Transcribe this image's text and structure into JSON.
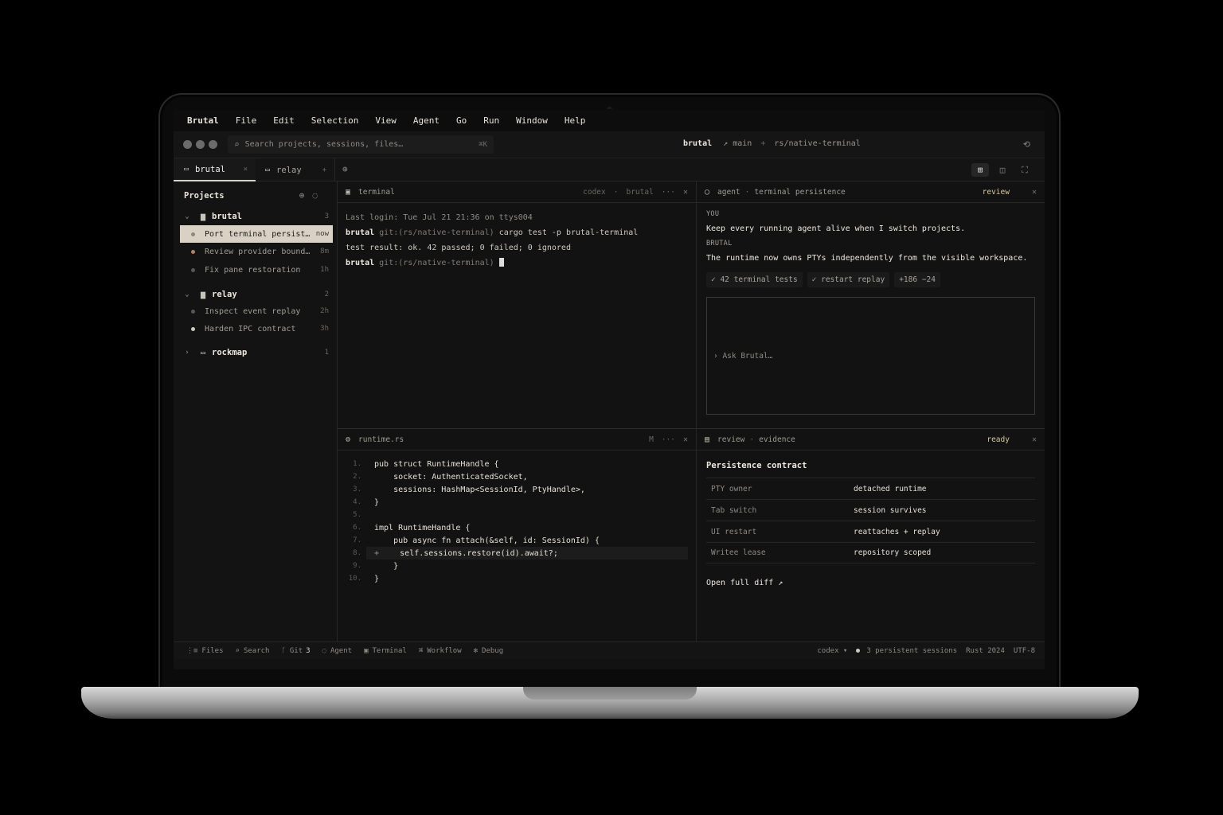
{
  "menu": [
    "Brutal",
    "File",
    "Edit",
    "Selection",
    "View",
    "Agent",
    "Go",
    "Run",
    "Window",
    "Help"
  ],
  "search": {
    "placeholder": "Search projects, sessions, files…",
    "shortcut": "⌘K"
  },
  "breadcrumb": {
    "project": "brutal",
    "branch_icon": "↗",
    "branch": "main",
    "sep": "+",
    "path": "rs/native-terminal"
  },
  "tabs": [
    {
      "label": "brutal",
      "close": "×"
    },
    {
      "label": "relay",
      "close": "+"
    }
  ],
  "sidebar": {
    "title": "Projects",
    "projects": [
      {
        "name": "brutal",
        "count": "3",
        "expanded": true,
        "sessions": [
          {
            "title": "Port terminal persist…",
            "time": "now",
            "active": true
          },
          {
            "title": "Review provider bound…",
            "time": "8m"
          },
          {
            "title": "Fix pane restoration",
            "time": "1h"
          }
        ]
      },
      {
        "name": "relay",
        "count": "2",
        "expanded": true,
        "sessions": [
          {
            "title": "Inspect event replay",
            "time": "2h"
          },
          {
            "title": "Harden IPC contract",
            "time": "3h"
          }
        ]
      },
      {
        "name": "rockmap",
        "count": "1",
        "expanded": false,
        "sessions": []
      }
    ]
  },
  "terminal": {
    "title": "terminal",
    "meta_provider": "codex",
    "meta_project": "brutal",
    "lines": {
      "login": "Last login: Tue Jul 21 21:36 on ttys004",
      "prompt": "brutal",
      "branch": "git:(rs/native-terminal)",
      "cmd": "cargo test -p brutal-terminal",
      "result": "test result: ok. 42 passed; 0 failed; 0 ignored"
    }
  },
  "agent": {
    "title": "agent",
    "subtitle": "terminal persistence",
    "status": "review",
    "you_label": "YOU",
    "you_msg": "Keep every running agent alive when I switch projects.",
    "bot_label": "BRUTAL",
    "bot_msg": "The runtime now owns PTYs independently from the visible workspace.",
    "chips": [
      "✓ 42 terminal tests",
      "✓ restart replay",
      "+186 −24"
    ],
    "ask_placeholder": "› Ask Brutal…"
  },
  "editor": {
    "filename": "runtime.rs",
    "badge": "M",
    "lines": [
      {
        "n": "1.",
        "code": "pub struct RuntimeHandle {"
      },
      {
        "n": "2.",
        "code": "    socket: AuthenticatedSocket,"
      },
      {
        "n": "3.",
        "code": "    sessions: HashMap<SessionId, PtyHandle>,"
      },
      {
        "n": "4.",
        "code": "}"
      },
      {
        "n": "5.",
        "code": ""
      },
      {
        "n": "6.",
        "code": "impl RuntimeHandle {"
      },
      {
        "n": "7.",
        "code": "    pub async fn attach(&self, id: SessionId) {"
      },
      {
        "n": "8.",
        "code": "        self.sessions.restore(id).await?;",
        "added": true
      },
      {
        "n": "9.",
        "code": "    }"
      },
      {
        "n": "10.",
        "code": "}"
      }
    ]
  },
  "evidence": {
    "title": "review",
    "subtitle": "evidence",
    "status": "ready",
    "heading": "Persistence contract",
    "rows": [
      {
        "k": "PTY owner",
        "v": "detached runtime"
      },
      {
        "k": "Tab switch",
        "v": "session survives"
      },
      {
        "k": "UI restart",
        "v": "reattaches + replay"
      },
      {
        "k": "Writee lease",
        "v": "repository scoped"
      }
    ],
    "link": "Open full diff ↗"
  },
  "status": {
    "items": [
      "Files",
      "Search",
      "Git",
      "Agent",
      "Terminal",
      "Workflow",
      "Debug"
    ],
    "git_count": "3",
    "provider": "codex ▾",
    "sessions": "3 persistent sessions",
    "lang": "Rust 2024",
    "encoding": "UTF-8"
  },
  "colors": {
    "accent": "#d6c79b",
    "active_row": "#d9d2c4",
    "bg": "#121212"
  }
}
